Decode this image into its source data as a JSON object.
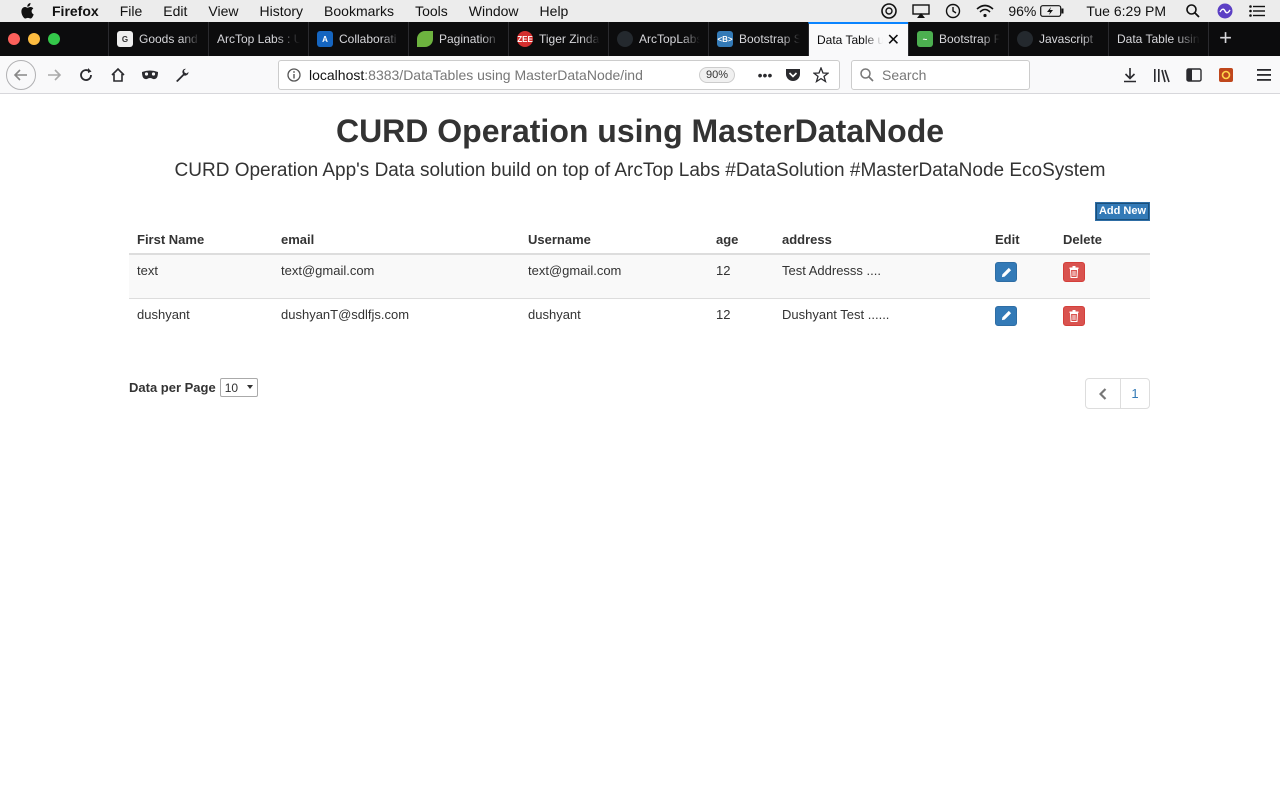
{
  "menubar": {
    "app": "Firefox",
    "items": [
      "File",
      "Edit",
      "View",
      "History",
      "Bookmarks",
      "Tools",
      "Window",
      "Help"
    ],
    "battery": "96%",
    "clock": "Tue 6:29 PM"
  },
  "tabs": [
    {
      "label": "Goods and",
      "color": "#ffffff",
      "fav": ""
    },
    {
      "label": "ArcTop Labs : U",
      "color": "",
      "fav": ""
    },
    {
      "label": "Collaborati",
      "color": "#1565c0",
      "fav": ""
    },
    {
      "label": "Pagination",
      "color": "#6db33f",
      "fav": ""
    },
    {
      "label": "Tiger Zinda",
      "color": "#d32f2f",
      "fav": "ZEE"
    },
    {
      "label": "ArcTopLabs",
      "color": "#24292e",
      "fav": ""
    },
    {
      "label": "Bootstrap S",
      "color": "#337ab7",
      "fav": "<B>"
    },
    {
      "label": "Data Table u",
      "color": "",
      "fav": "",
      "active": true
    },
    {
      "label": "Bootstrap F",
      "color": "#4caf50",
      "fav": ""
    },
    {
      "label": "Javascript",
      "color": "#24292e",
      "fav": ""
    },
    {
      "label": "Data Table usin",
      "color": "",
      "fav": ""
    }
  ],
  "navbar": {
    "url_host": "localhost",
    "url_path": ":8383/DataTables using MasterDataNode/ind",
    "zoom": "90%",
    "search_placeholder": "Search"
  },
  "page": {
    "title": "CURD Operation using MasterDataNode",
    "subtitle": "CURD Operation App's Data solution build on top of ArcTop Labs #DataSolution #MasterDataNode EcoSystem",
    "add_new": "Add New",
    "per_page_label": "Data per Page",
    "per_page_value": "10",
    "current_page": "1"
  },
  "table": {
    "headers": [
      "First Name",
      "email",
      "Username",
      "age",
      "address",
      "Edit",
      "Delete"
    ],
    "rows": [
      {
        "first_name": "text",
        "email": "text@gmail.com",
        "username": "text@gmail.com",
        "age": "12",
        "address": "Test Addresss ...."
      },
      {
        "first_name": "dushyant",
        "email": "dushyanT@sdlfjs.com",
        "username": "dushyant",
        "age": "12",
        "address": "Dushyant Test ......"
      }
    ]
  }
}
